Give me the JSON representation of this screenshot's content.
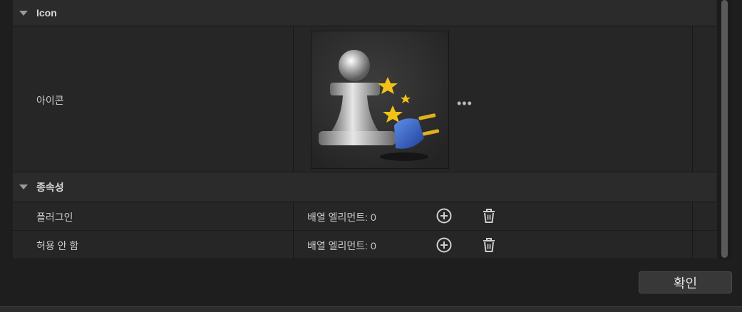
{
  "sections": {
    "icon": {
      "title": "Icon",
      "row_label": "아이콘",
      "browse_label": "•••"
    },
    "deps": {
      "title": "종속성",
      "rows": [
        {
          "label": "플러그인",
          "value": "배열 엘리먼트: 0"
        },
        {
          "label": "허용 안 함",
          "value": "배열 엘리먼트: 0"
        }
      ]
    }
  },
  "footer": {
    "ok_label": "확인"
  },
  "colors": {
    "background": "#1e1e1e",
    "panel": "#262626",
    "header": "#2b2b2b",
    "star": "#f2c316",
    "plug": "#2f5fc8"
  },
  "icons": [
    "expand-arrow-icon",
    "add-circle-icon",
    "trash-icon",
    "plugin-pawn-icon"
  ]
}
